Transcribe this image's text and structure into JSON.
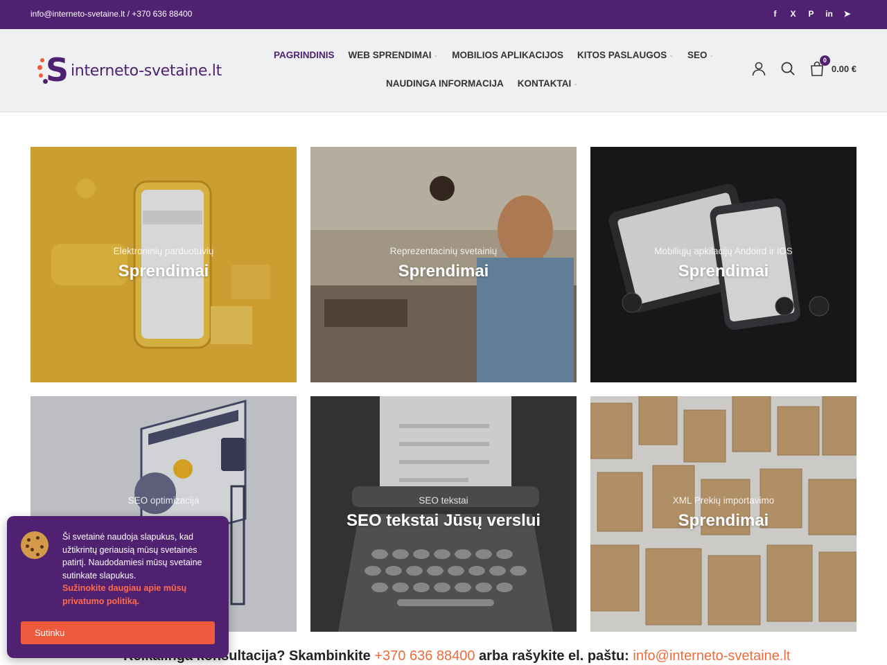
{
  "topbar": {
    "contact": "info@interneto-svetaine.lt / +370 636 88400",
    "socials": [
      {
        "icon": "facebook-icon",
        "glyph": "f"
      },
      {
        "icon": "x-icon",
        "glyph": "X"
      },
      {
        "icon": "pinterest-icon",
        "glyph": "P"
      },
      {
        "icon": "linkedin-icon",
        "glyph": "in"
      },
      {
        "icon": "telegram-icon",
        "glyph": "➤"
      }
    ]
  },
  "header": {
    "logo_text": "interneto-svetaine.lt",
    "nav_row1": [
      {
        "label": "PAGRINDINIS",
        "active": true,
        "dropdown": false
      },
      {
        "label": "WEB SPRENDIMAI",
        "active": false,
        "dropdown": true
      },
      {
        "label": "MOBILIOS APLIKACIJOS",
        "active": false,
        "dropdown": false
      },
      {
        "label": "KITOS PASLAUGOS",
        "active": false,
        "dropdown": true
      },
      {
        "label": "SEO",
        "active": false,
        "dropdown": true
      }
    ],
    "nav_row2": [
      {
        "label": "NAUDINGA INFORMACIJA",
        "active": false,
        "dropdown": false
      },
      {
        "label": "KONTAKTAI",
        "active": false,
        "dropdown": true
      }
    ],
    "cart_count": "0",
    "cart_total": "0.00 €"
  },
  "tiles": [
    {
      "subtitle": "Elektroninių parduotuvių",
      "title": "Sprendimai"
    },
    {
      "subtitle": "Reprezentacinių svetainių",
      "title": "Sprendimai"
    },
    {
      "subtitle": "Mobiliųjų apkilacijų Andoird ir iOS",
      "title": "Sprendimai"
    },
    {
      "subtitle": "SEO optimizacija",
      "title": ""
    },
    {
      "subtitle": "SEO tekstai",
      "title": "SEO tekstai Jūsų verslui"
    },
    {
      "subtitle": "XML Prekių importavimo",
      "title": "Sprendimai"
    }
  ],
  "consult": {
    "prefix": "Reikalinga konsultacija? Skambinkite ",
    "phone": "+370 636 88400",
    "middle": " arba rašykite el. paštu: ",
    "email": "info@interneto-svetaine.lt"
  },
  "cookie": {
    "text": "Ši svetainė naudoja slapukus, kad užtikrintų geriausią mūsų svetainės patirtį. Naudodamiesi mūsų svetaine sutinkate slapukus.",
    "link": "Sužinokite daugiau apie mūsų privatumo politiką.",
    "button": "Sutinku"
  },
  "colors": {
    "brand": "#4f2170",
    "accent": "#ee5b3c"
  }
}
